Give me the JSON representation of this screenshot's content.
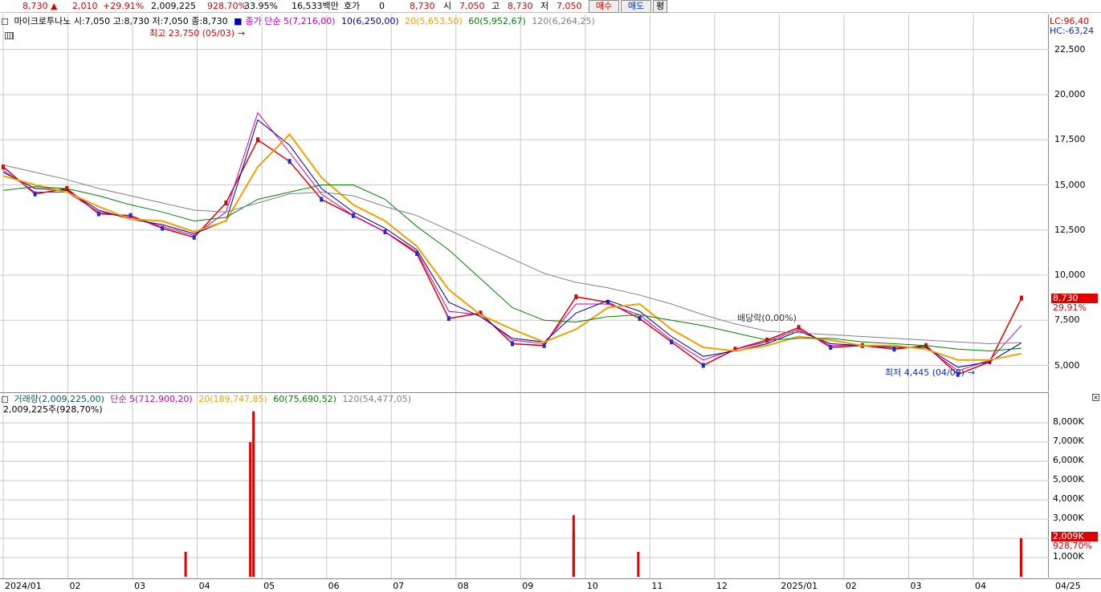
{
  "toolbar": {
    "price": "8,730",
    "change": "2,010",
    "change_pct": "+29.91%",
    "volume": "2,009,225",
    "volume_ratio": "928.70%",
    "turnover": "33.95%",
    "amount": "16,533백만",
    "quote_label": "호가",
    "quote_value": "0",
    "quote_price": "8,730",
    "open_label": "시",
    "open": "7,050",
    "high_label": "고",
    "high": "8,730",
    "low_label": "저",
    "low": "7,050",
    "buy_label": "매수",
    "sell_label": "매도",
    "flat_label": "평"
  },
  "price_legend": {
    "title": "마이크로투나노 시:7,050 고:8,730 저:7,050 종:8,730",
    "ma_label": "종가 단순 5(7,216,00)",
    "ma10": "10(6,250,00)",
    "ma20": "20(5,653,50)",
    "ma60": "60(5,952,67)",
    "ma120": "120(6,264,25)"
  },
  "volume_legend": {
    "title": "거래량(2,009,225,00)",
    "ma5": "단순 5(712,900,20)",
    "ma20": "20(189,747,85)",
    "ma60": "60(75,690,52)",
    "ma120": "120(54,477,05)",
    "current": "2,009,225주(928,70%)"
  },
  "annotations": {
    "high": "최고 23,750 (05/03)",
    "low": "최저 4,445 (04/09)",
    "dividend": "배당락(0,00%)"
  },
  "price_axis": {
    "lc": "LC:96,40",
    "hc": "HC:-63,24",
    "ticks": [
      "22,500",
      "20,000",
      "17,500",
      "15,000",
      "12,500",
      "10,000",
      "7,500",
      "5,000"
    ],
    "current_price": "8,730",
    "current_pct": "29,91%"
  },
  "volume_axis": {
    "ticks": [
      "8,000K",
      "7,000K",
      "6,000K",
      "5,000K",
      "4,000K",
      "3,000K",
      "2,000K",
      "1,000K"
    ],
    "current_volume": "2,009K",
    "current_pct": "928,70%"
  },
  "x_axis": {
    "labels": [
      "2024/01",
      "02",
      "03",
      "04",
      "05",
      "06",
      "07",
      "08",
      "09",
      "10",
      "11",
      "12",
      "2025/01",
      "02",
      "03",
      "04",
      "04/25"
    ]
  },
  "colors": {
    "up": "#e00000",
    "down": "#1030c8",
    "ma5": "#c000c0",
    "ma10": "#000080",
    "ma20": "#f0a000",
    "ma60": "#008000",
    "ma120": "#808080",
    "grid": "#c8c8c8"
  },
  "chart_data": {
    "type": "line",
    "title": "마이크로투나노",
    "price_ylim": [
      4000,
      24000
    ],
    "volume_ylim": [
      0,
      8800000
    ],
    "price_series": {
      "name": "종가",
      "x": [
        "2024/01",
        "2024/01",
        "2024/02",
        "2024/02",
        "2024/03",
        "2024/03",
        "2024/04",
        "2024/04",
        "2024/05",
        "2024/05",
        "2024/06",
        "2024/06",
        "2024/07",
        "2024/07",
        "2024/08",
        "2024/08",
        "2024/09",
        "2024/09",
        "2024/10",
        "2024/10",
        "2024/11",
        "2024/11",
        "2024/12",
        "2024/12",
        "2025/01",
        "2025/01",
        "2025/02",
        "2025/02",
        "2025/03",
        "2025/03",
        "2025/04",
        "2025/04",
        "2025/04/25"
      ],
      "y": [
        16000,
        14500,
        14800,
        13400,
        13300,
        12600,
        12100,
        14000,
        17500,
        16300,
        14200,
        13300,
        12400,
        11200,
        7600,
        7900,
        6200,
        6100,
        8800,
        8500,
        7600,
        6300,
        5000,
        5900,
        6400,
        7100,
        6000,
        6100,
        5900,
        6100,
        4500,
        5200,
        8730
      ]
    },
    "volume_series": {
      "name": "거래량",
      "x": [
        "2024/04",
        "2024/05",
        "2024/05",
        "2024/10",
        "2024/10",
        "2024/11",
        "2025/04/25"
      ],
      "y": [
        1300000,
        7000000,
        8600000,
        3200000,
        2300000,
        1300000,
        2009225
      ]
    },
    "ma_series": [
      {
        "name": "5",
        "y": [
          15800,
          14600,
          14600,
          13500,
          13200,
          12700,
          12200,
          13500,
          19000,
          16800,
          14500,
          13300,
          12400,
          11300,
          8000,
          7800,
          6400,
          6200,
          8400,
          8400,
          7800,
          6400,
          5300,
          5900,
          6300,
          7000,
          6100,
          6100,
          6000,
          6000,
          4700,
          5300,
          7216
        ]
      },
      {
        "name": "10",
        "y": [
          15700,
          14800,
          14700,
          13600,
          13100,
          12800,
          12300,
          13000,
          18600,
          17200,
          14800,
          13500,
          12600,
          11400,
          8500,
          7700,
          6500,
          6300,
          7900,
          8600,
          8000,
          6600,
          5500,
          5800,
          6200,
          6900,
          6200,
          6100,
          6000,
          6000,
          4900,
          5200,
          6250
        ]
      },
      {
        "name": "20",
        "y": [
          15500,
          15000,
          14600,
          13800,
          13100,
          13000,
          12400,
          13000,
          16000,
          17800,
          15400,
          13900,
          13000,
          11600,
          9200,
          7800,
          7000,
          6300,
          7000,
          8200,
          8400,
          7000,
          6000,
          5800,
          6100,
          6600,
          6400,
          6100,
          6100,
          5900,
          5300,
          5300,
          5653
        ]
      },
      {
        "name": "60",
        "y": [
          14700,
          14900,
          14800,
          14400,
          13900,
          13500,
          13000,
          13200,
          14200,
          14600,
          15000,
          15000,
          14200,
          12700,
          11400,
          9800,
          8200,
          7500,
          7400,
          7700,
          7800,
          7500,
          7200,
          6800,
          6400,
          6500,
          6500,
          6300,
          6200,
          6100,
          5900,
          5800,
          5952
        ]
      },
      {
        "name": "120",
        "y": [
          16100,
          15700,
          15300,
          14800,
          14400,
          14000,
          13600,
          13500,
          14000,
          14500,
          14600,
          14400,
          13800,
          13300,
          12500,
          11700,
          10900,
          10100,
          9600,
          9300,
          8900,
          8400,
          7800,
          7300,
          6900,
          6800,
          6700,
          6600,
          6500,
          6400,
          6300,
          6200,
          6264
        ]
      }
    ]
  }
}
